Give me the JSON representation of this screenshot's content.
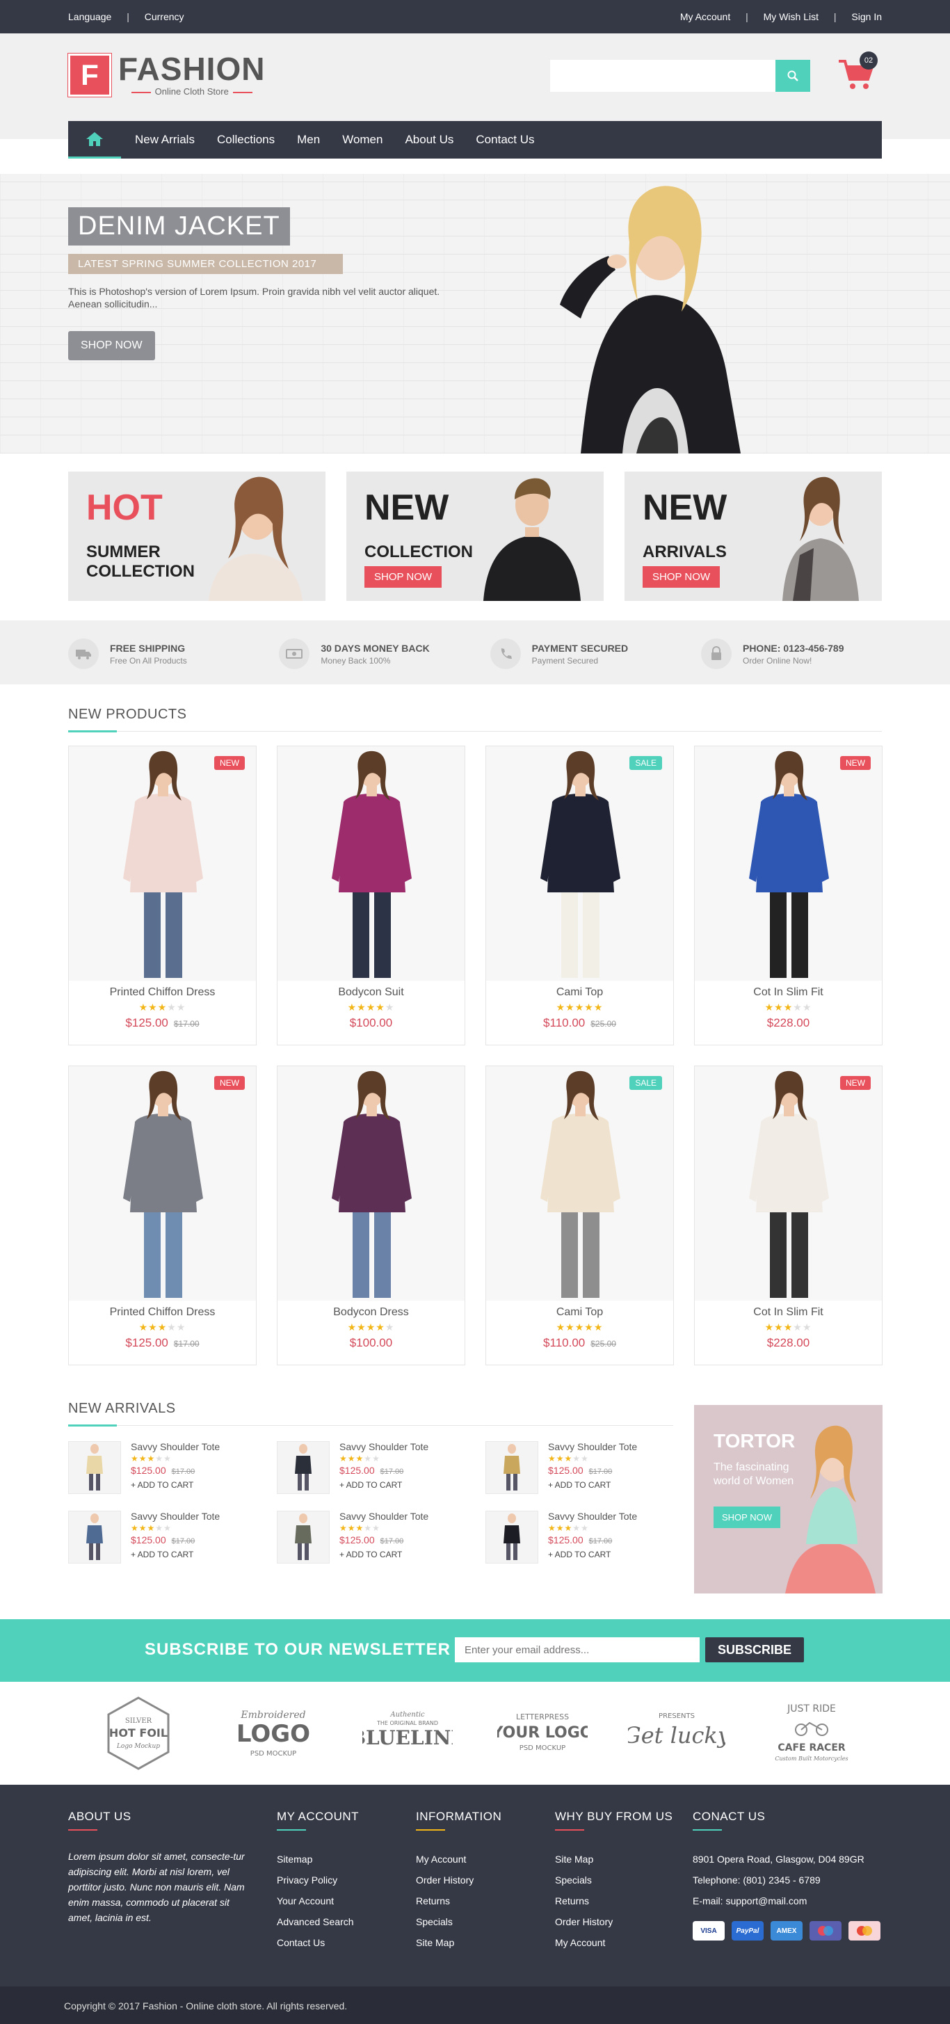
{
  "topbar": {
    "language": "Language",
    "currency": "Currency",
    "account": "My Account",
    "wishlist": "My Wish List",
    "signin": "Sign In"
  },
  "logo": {
    "letter": "F",
    "name": "FASHION",
    "tagline": "Online Cloth Store"
  },
  "cart": {
    "count": "02"
  },
  "nav": [
    "New Arrials",
    "Collections",
    "Men",
    "Women",
    "About Us",
    "Contact Us"
  ],
  "hero": {
    "title": "DENIM JACKET",
    "subtitle": "LATEST SPRING SUMMER COLLECTION 2017",
    "desc": "This is Photoshop's version of Lorem Ipsum. Proin gravida nibh vel velit auctor aliquet. Aenean sollicitudin...",
    "button": "SHOP NOW"
  },
  "banners": [
    {
      "big": "HOT",
      "line1": "SUMMER",
      "line2": "COLLECTION",
      "button": ""
    },
    {
      "big": "NEW",
      "line1": "COLLECTION",
      "line2": "",
      "button": "SHOP NOW"
    },
    {
      "big": "NEW",
      "line1": "ARRIVALS",
      "line2": "",
      "button": "SHOP NOW"
    }
  ],
  "features": [
    {
      "title": "FREE SHIPPING",
      "sub": "Free On All Products",
      "icon": "truck-icon"
    },
    {
      "title": "30 DAYS MONEY BACK",
      "sub": "Money Back 100%",
      "icon": "money-icon"
    },
    {
      "title": "PAYMENT SECURED",
      "sub": "Payment Secured",
      "icon": "phone-icon"
    },
    {
      "title": "PHONE: 0123-456-789",
      "sub": "Order Online Now!",
      "icon": "lock-icon"
    }
  ],
  "new_products": {
    "title": "NEW PRODUCTS",
    "items": [
      {
        "name": "Printed Chiffon Dress",
        "rating": 3,
        "price": "$125.00",
        "old": "$17.00",
        "badge": "NEW",
        "shirt": "#f1d9d3",
        "pants": "#5a6f8f"
      },
      {
        "name": "Bodycon Suit",
        "rating": 4,
        "price": "$100.00",
        "old": "",
        "badge": "",
        "shirt": "#9c2c6b",
        "pants": "#2c3347"
      },
      {
        "name": "Cami Top",
        "rating": 5,
        "price": "$110.00",
        "old": "$25.00",
        "badge": "SALE",
        "shirt": "#1f2233",
        "pants": "#f2efe6"
      },
      {
        "name": "Cot In Slim Fit",
        "rating": 3,
        "price": "$228.00",
        "old": "",
        "badge": "NEW",
        "shirt": "#2e57b4",
        "pants": "#222"
      },
      {
        "name": "Printed Chiffon Dress",
        "rating": 3,
        "price": "$125.00",
        "old": "$17.00",
        "badge": "NEW",
        "shirt": "#7b7e86",
        "pants": "#6f8db0"
      },
      {
        "name": "Bodycon Dress",
        "rating": 4,
        "price": "$100.00",
        "old": "",
        "badge": "",
        "shirt": "#5d2f55",
        "pants": "#6a82a8"
      },
      {
        "name": "Cami Top",
        "rating": 5,
        "price": "$110.00",
        "old": "$25.00",
        "badge": "SALE",
        "shirt": "#efe3cf",
        "pants": "#8e8e8e"
      },
      {
        "name": "Cot In Slim Fit",
        "rating": 3,
        "price": "$228.00",
        "old": "",
        "badge": "NEW",
        "shirt": "#f1ede6",
        "pants": "#333"
      }
    ]
  },
  "arrivals": {
    "title": "NEW ARRIVALS",
    "add_label": "+ ADD TO CART",
    "items": [
      {
        "name": "Savvy Shoulder Tote",
        "rating": 3,
        "price": "$125.00",
        "old": "$17.00",
        "color": "#e9d7a8"
      },
      {
        "name": "Savvy Shoulder Tote",
        "rating": 3,
        "price": "$125.00",
        "old": "$17.00",
        "color": "#2b2f3a"
      },
      {
        "name": "Savvy Shoulder Tote",
        "rating": 3,
        "price": "$125.00",
        "old": "$17.00",
        "color": "#c9a85e"
      },
      {
        "name": "Savvy Shoulder Tote",
        "rating": 3,
        "price": "$125.00",
        "old": "$17.00",
        "color": "#4f6b93"
      },
      {
        "name": "Savvy Shoulder Tote",
        "rating": 3,
        "price": "$125.00",
        "old": "$17.00",
        "color": "#676b5e"
      },
      {
        "name": "Savvy Shoulder Tote",
        "rating": 3,
        "price": "$125.00",
        "old": "$17.00",
        "color": "#1c1c24"
      }
    ]
  },
  "promo": {
    "title": "TORTOR",
    "sub": "The fascinating world of Women",
    "button": "SHOP NOW"
  },
  "newsletter": {
    "title": "SUBSCRIBE TO OUR NEWSLETTER !",
    "placeholder": "Enter your email address...",
    "button": "SUBSCRIBE"
  },
  "brands": [
    {
      "l1": "SILVER",
      "l2": "HOT FOIL",
      "l3": "Logo Mockup"
    },
    {
      "l1": "Embroidered",
      "l2": "LOGO",
      "l3": "PSD MOCKUP"
    },
    {
      "l1": "Authentic",
      "l2": "BLUELINE",
      "l3": "THE ORIGINAL BRAND"
    },
    {
      "l1": "LETTERPRESS",
      "l2": "YOUR LOGO",
      "l3": "PSD MOCKUP"
    },
    {
      "l1": "PRESENTS",
      "l2": "Get lucky",
      "l3": ""
    },
    {
      "l1": "JUST RIDE",
      "l2": "CAFE RACER",
      "l3": "Custom Built Motorcycles"
    }
  ],
  "footer": {
    "about_title": "ABOUT US",
    "about_text": "Lorem ipsum dolor sit amet, consecte-tur adipiscing elit. Morbi at nisl lorem, vel porttitor justo. Nunc non mauris elit. Nam enim massa, commodo ut placerat sit amet, lacinia in est.",
    "account_title": "MY ACCOUNT",
    "account_links": [
      "Sitemap",
      "Privacy Policy",
      "Your Account",
      "Advanced Search",
      "Contact Us"
    ],
    "info_title": "INFORMATION",
    "info_links": [
      "My Account",
      "Order History",
      "Returns",
      "Specials",
      "Site Map"
    ],
    "why_title": "WHY BUY FROM US",
    "why_links": [
      "Site Map",
      "Specials",
      "Returns",
      "Order History",
      "My Account"
    ],
    "contact_title": "CONACT US",
    "contact": [
      "8901 Opera Road, Glasgow, D04 89GR",
      "Telephone: (801) 2345 - 6789",
      "E-mail: support@mail.com"
    ],
    "payments": [
      "VISA",
      "PayPal",
      "AMEX",
      "Maestro",
      "MasterCard"
    ],
    "copyright": "Copyright © 2017 Fashion - Online cloth store. All rights reserved."
  },
  "colors": {
    "accent": "#4fd1bb",
    "red": "#e8505b",
    "dark": "#353946",
    "star": "#f2b619"
  }
}
